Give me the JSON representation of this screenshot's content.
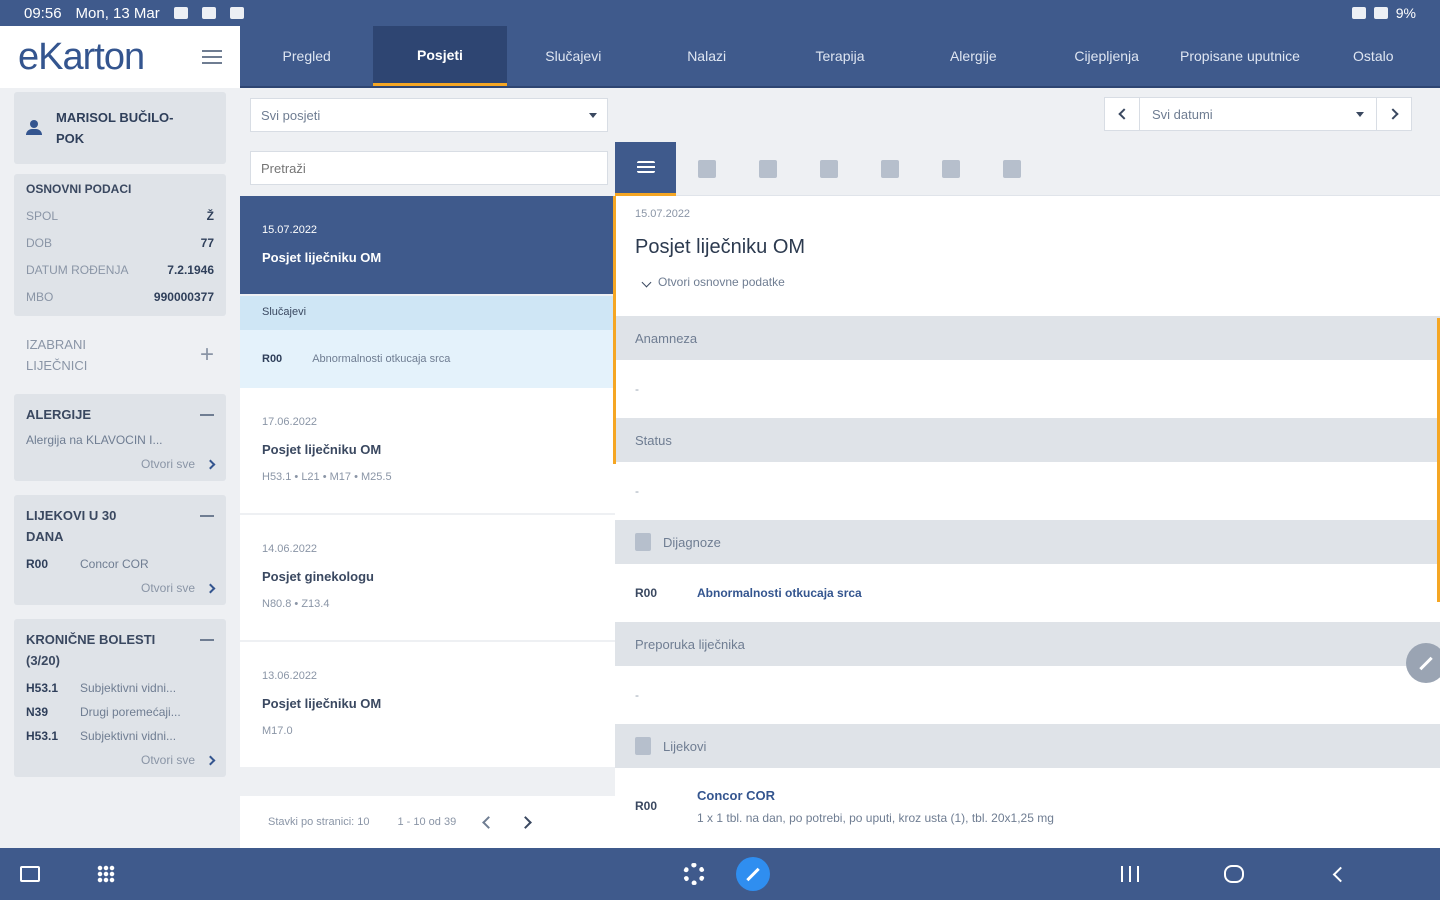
{
  "status_bar": {
    "time": "09:56",
    "date": "Mon, 13 Mar",
    "battery": "9%"
  },
  "app": {
    "logo": "eKarton"
  },
  "patient": {
    "name": "MARISOL BUČILO-POK"
  },
  "basic": {
    "title": "OSNOVNI PODACI",
    "rows": [
      {
        "label": "SPOL",
        "value": "Ž"
      },
      {
        "label": "DOB",
        "value": "77"
      },
      {
        "label": "DATUM ROĐENJA",
        "value": "7.2.1946"
      },
      {
        "label": "MBO",
        "value": "990000377"
      }
    ]
  },
  "favorites": {
    "label": "IZABRANI LIJEČNICI"
  },
  "allergies": {
    "title": "ALERGIJE",
    "text": "Alergija na KLAVOCIN I...",
    "open_all": "Otvori sve"
  },
  "meds30": {
    "title": "LIJEKOVI U 30 DANA",
    "items": [
      {
        "code": "R00",
        "name": "Concor COR"
      }
    ],
    "open_all": "Otvori sve"
  },
  "chronic": {
    "title": "KRONIČNE BOLESTI (3/20)",
    "items": [
      {
        "code": "H53.1",
        "name": "Subjektivni vidni..."
      },
      {
        "code": "N39",
        "name": "Drugi poremećaji..."
      },
      {
        "code": "H53.1",
        "name": "Subjektivni vidni..."
      }
    ],
    "open_all": "Otvori sve"
  },
  "tabs": [
    "Pregled",
    "Posjeti",
    "Slučajevi",
    "Nalazi",
    "Terapija",
    "Alergije",
    "Cijepljenja",
    "Propisane uputnice",
    "Ostalo"
  ],
  "active_tab": "Posjeti",
  "list": {
    "filter": "Svi posjeti",
    "search_placeholder": "Pretraži",
    "selected": {
      "date": "15.07.2022",
      "name": "Posjet liječniku OM"
    },
    "cases_header": "Slučajevi",
    "case": {
      "code": "R00",
      "name": "Abnormalnosti otkucaja srca"
    },
    "visits": [
      {
        "date": "17.06.2022",
        "name": "Posjet liječniku OM",
        "codes": "H53.1 • L21 • M17 • M25.5"
      },
      {
        "date": "14.06.2022",
        "name": "Posjet ginekologu",
        "codes": "N80.8 • Z13.4"
      },
      {
        "date": "13.06.2022",
        "name": "Posjet liječniku OM",
        "codes": "M17.0"
      }
    ],
    "pager": {
      "per_page": "Stavki po stranici: 10",
      "range": "1 - 10 od 39"
    }
  },
  "detail": {
    "date_filter": "Svi datumi",
    "date": "15.07.2022",
    "title": "Posjet liječniku OM",
    "open_basic": "Otvori osnovne podatke",
    "anamnesis": {
      "title": "Anamneza",
      "value": "-"
    },
    "status": {
      "title": "Status",
      "value": "-"
    },
    "diagnoses": {
      "title": "Dijagnoze",
      "code": "R00",
      "name": "Abnormalnosti otkucaja srca"
    },
    "recommendation": {
      "title": "Preporuka liječnika",
      "value": "-"
    },
    "medications": {
      "title": "Lijekovi",
      "code": "R00",
      "name": "Concor COR",
      "dosage": "1 x 1 tbl. na dan, po potrebi, po uputi, kroz usta (1), tbl. 20x1,25 mg"
    }
  },
  "colors": {
    "primary": "#3f5a8c",
    "accent": "#f5a623",
    "link": "#34558f"
  }
}
